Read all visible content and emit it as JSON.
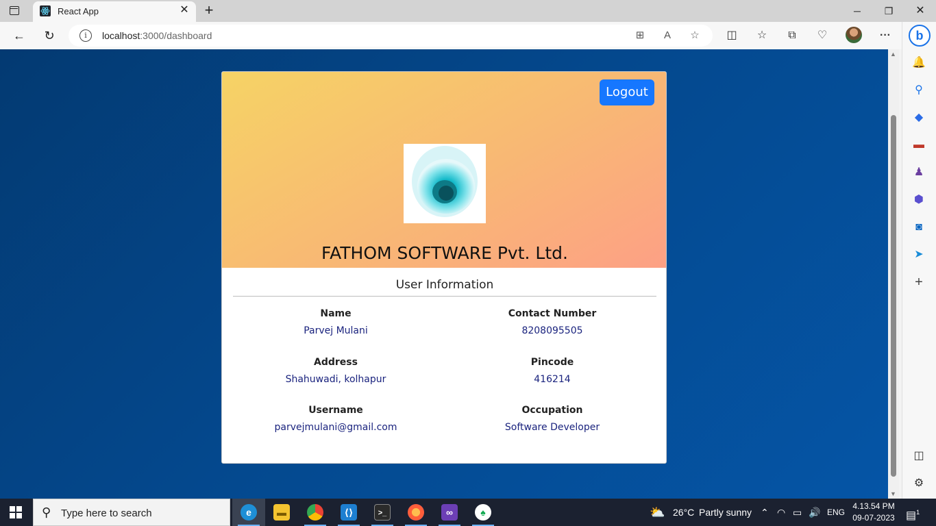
{
  "browser": {
    "tab_title": "React App",
    "url_host": "localhost",
    "url_path": ":3000/dashboard"
  },
  "page": {
    "logout_label": "Logout",
    "company_name": "FATHOM SOFTWARE Pvt. Ltd.",
    "section_title": "User Information",
    "fields": [
      {
        "label": "Name",
        "value": "Parvej Mulani"
      },
      {
        "label": "Contact Number",
        "value": "8208095505"
      },
      {
        "label": "Address",
        "value": "Shahuwadi, kolhapur"
      },
      {
        "label": "Pincode",
        "value": "416214"
      },
      {
        "label": "Username",
        "value": "parvejmulani@gmail.com"
      },
      {
        "label": "Occupation",
        "value": "Software Developer"
      }
    ]
  },
  "taskbar": {
    "search_placeholder": "Type here to search",
    "weather_temp": "26°C",
    "weather_text": "Partly sunny",
    "language": "ENG",
    "time": "4.13.54 PM",
    "date": "09-07-2023",
    "notification_count": "1"
  },
  "colors": {
    "page_background": "#04498f",
    "logout_button": "#1677ff",
    "field_value": "#1a237e",
    "hero_gradient_start": "#f6d365",
    "hero_gradient_end": "#fda085"
  }
}
